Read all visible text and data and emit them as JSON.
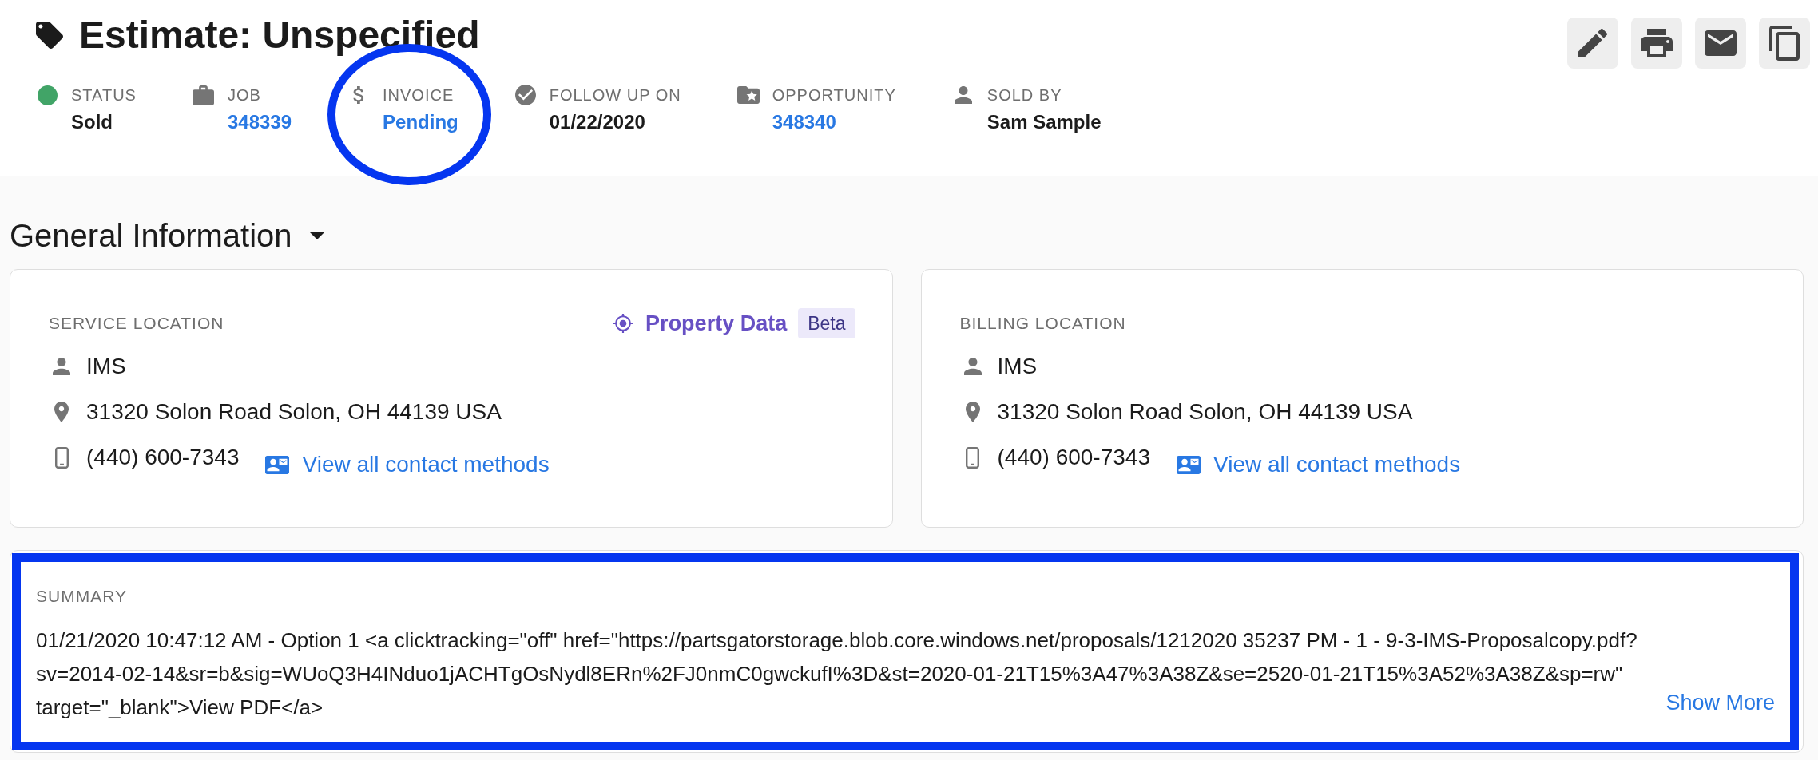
{
  "header": {
    "title": "Estimate: Unspecified"
  },
  "meta": [
    {
      "kind": "status",
      "label": "STATUS",
      "value": "Sold",
      "link": false,
      "color": "#41a467",
      "highlighted": false
    },
    {
      "kind": "job",
      "label": "JOB",
      "value": "348339",
      "link": true,
      "highlighted": false
    },
    {
      "kind": "invoice",
      "label": "INVOICE",
      "value": "Pending",
      "link": true,
      "highlighted": true
    },
    {
      "kind": "follow_up",
      "label": "FOLLOW UP ON",
      "value": "01/22/2020",
      "link": false,
      "highlighted": false
    },
    {
      "kind": "opportunity",
      "label": "OPPORTUNITY",
      "value": "348340",
      "link": true,
      "highlighted": false
    },
    {
      "kind": "sold_by",
      "label": "SOLD BY",
      "value": "Sam Sample",
      "link": false,
      "highlighted": false
    }
  ],
  "section": {
    "title": "General Information",
    "expanded": true
  },
  "locations": [
    {
      "label": "SERVICE LOCATION",
      "property_data": {
        "label": "Property Data",
        "badge": "Beta"
      },
      "name": "IMS",
      "address": "31320 Solon Road Solon, OH 44139 USA",
      "phone": "(440) 600-7343",
      "contact_link": "View all contact methods"
    },
    {
      "label": "BILLING LOCATION",
      "name": "IMS",
      "address": "31320 Solon Road Solon, OH 44139 USA",
      "phone": "(440) 600-7343",
      "contact_link": "View all contact methods"
    }
  ],
  "summary": {
    "label": "SUMMARY",
    "text": "01/21/2020 10:47:12 AM - Option 1 <a clicktracking=\"off\" href=\"https://partsgatorstorage.blob.core.windows.net/proposals/1212020 35237 PM - 1 - 9-3-IMS-Proposalcopy.pdf?sv=2014-02-14&sr=b&sig=WUoQ3H4INduo1jACHTgOsNydl8ERn%2FJ0nmC0gwckufI%3D&st=2020-01-21T15%3A47%3A38Z&se=2520-01-21T15%3A52%3A38Z&sp=rw\" target=\"_blank\">View PDF</a>",
    "more": "Show More",
    "highlighted": true
  }
}
